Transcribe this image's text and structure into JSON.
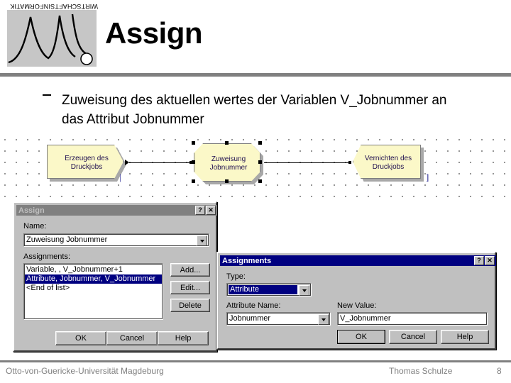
{
  "header": {
    "logo_caption": "WIRTSCHAFTSINFORMATIK",
    "title": "Assign"
  },
  "bullet": {
    "marker": "–",
    "text": "Zuweisung des aktuellen wertes der Variablen V_Jobnummer an das Attribut Jobnummer"
  },
  "model": {
    "nodes": [
      {
        "id": "create",
        "line1": "Erzeugen des",
        "line2": "Druckjobs"
      },
      {
        "id": "assign",
        "line1": "Zuweisung",
        "line2": "Jobnummer"
      },
      {
        "id": "destroy",
        "line1": "Vernichten des",
        "line2": "Druckjobs"
      }
    ],
    "brace_left": "|",
    "brace_right": "]"
  },
  "assign_dialog": {
    "title": "Assign",
    "help_btn": "?",
    "close_btn": "✕",
    "name_label": "Name:",
    "name_value": "Zuweisung Jobnummer",
    "assignments_label": "Assignments:",
    "assignments_items": [
      {
        "text": "Variable, , V_Jobnummer+1",
        "selected": false
      },
      {
        "text": "Attribute, Jobnummer, V_Jobnummer",
        "selected": true
      },
      {
        "text": "<End of list>",
        "selected": false
      }
    ],
    "add_button": "Add...",
    "edit_button": "Edit...",
    "delete_button": "Delete",
    "ok_button": "OK",
    "cancel_button": "Cancel",
    "help_button": "Help"
  },
  "assignments_dialog": {
    "title": "Assignments",
    "help_btn": "?",
    "close_btn": "✕",
    "type_label": "Type:",
    "type_value": "Attribute",
    "attribute_name_label": "Attribute Name:",
    "attribute_name_value": "Jobnummer",
    "new_value_label": "New Value:",
    "new_value_value": "V_Jobnummer",
    "ok_button": "OK",
    "cancel_button": "Cancel",
    "help_button": "Help"
  },
  "footer": {
    "left": "Otto-von-Guericke-Universität Magdeburg",
    "right": "Thomas Schulze",
    "page": "8"
  },
  "colors": {
    "title_active": "#000080",
    "title_inactive": "#808080",
    "dialog_face": "#c0c0c0",
    "node_fill": "#fbf8c8",
    "rule": "#808080",
    "footer_text": "#808080"
  }
}
